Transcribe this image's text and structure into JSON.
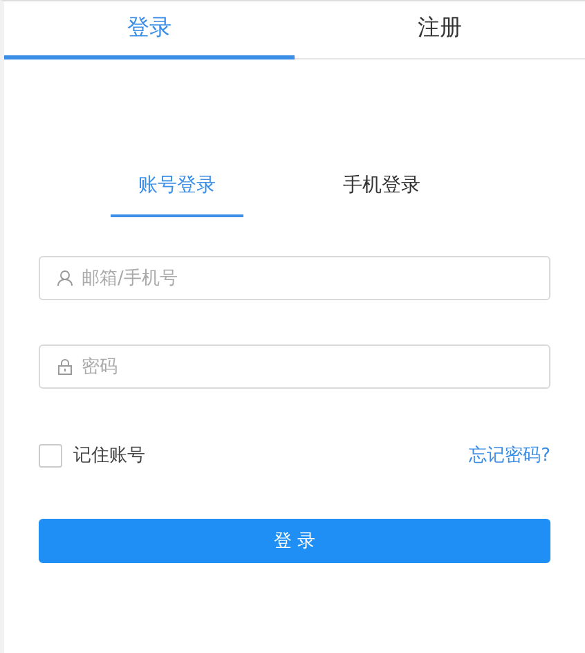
{
  "tabs": [
    {
      "label": "登录",
      "selected": true
    },
    {
      "label": "注册",
      "selected": false
    }
  ],
  "login_modes": [
    {
      "label": "账号登录",
      "selected": true
    },
    {
      "label": "手机登录",
      "selected": false
    }
  ],
  "fields": [
    {
      "kind": "user",
      "placeholder": "邮箱/手机号"
    },
    {
      "kind": "lock",
      "placeholder": "密码"
    }
  ],
  "remember": {
    "label": "记住账号",
    "checked": false
  },
  "forgot_link": "忘记密码?",
  "submit_button": "登 录"
}
